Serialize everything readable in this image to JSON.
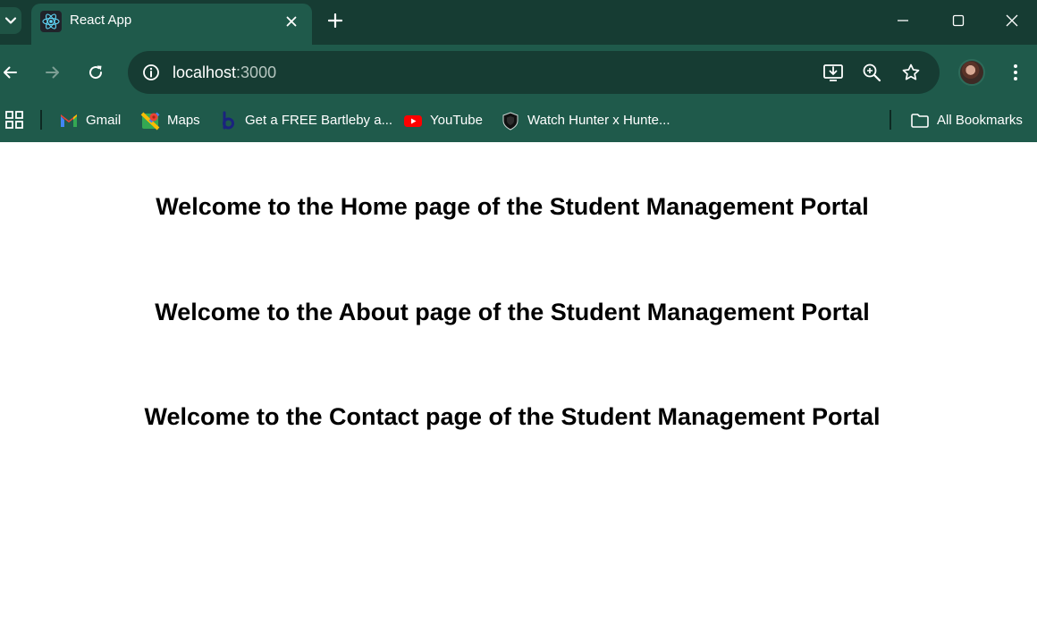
{
  "browser": {
    "tab": {
      "title": "React App",
      "favicon": "react-logo-icon"
    },
    "address_bar": {
      "host": "localhost",
      "port": ":3000"
    },
    "icons": {
      "tab_search": "chevron-down-icon",
      "new_tab": "plus-icon",
      "minimize": "minimize-icon",
      "maximize": "maximize-icon",
      "close": "close-icon",
      "back": "back-arrow-icon",
      "forward": "forward-arrow-icon",
      "reload": "reload-icon",
      "site_info": "info-icon",
      "install": "install-app-icon",
      "zoom": "zoom-icon",
      "bookmark": "star-icon",
      "menu": "kebab-menu-icon"
    },
    "colors": {
      "frame": "#163c33",
      "toolbar": "#1f5a4b",
      "page": "#ffffff"
    }
  },
  "bookmarks": {
    "apps_icon": "apps-grid-icon",
    "items": [
      {
        "label": "Gmail",
        "icon": "gmail-icon"
      },
      {
        "label": "Maps",
        "icon": "maps-icon"
      },
      {
        "label": "Get a FREE Bartleby a...",
        "icon": "bartleby-icon"
      },
      {
        "label": "YouTube",
        "icon": "youtube-icon"
      },
      {
        "label": "Watch Hunter x Hunte...",
        "icon": "shield-icon"
      }
    ],
    "all_bookmarks": {
      "label": "All Bookmarks",
      "icon": "folder-icon"
    }
  },
  "page": {
    "headings": [
      "Welcome to the Home page of the Student Management Portal",
      "Welcome to the About page of the Student Management Portal",
      "Welcome to the Contact page of the Student Management Portal"
    ]
  }
}
